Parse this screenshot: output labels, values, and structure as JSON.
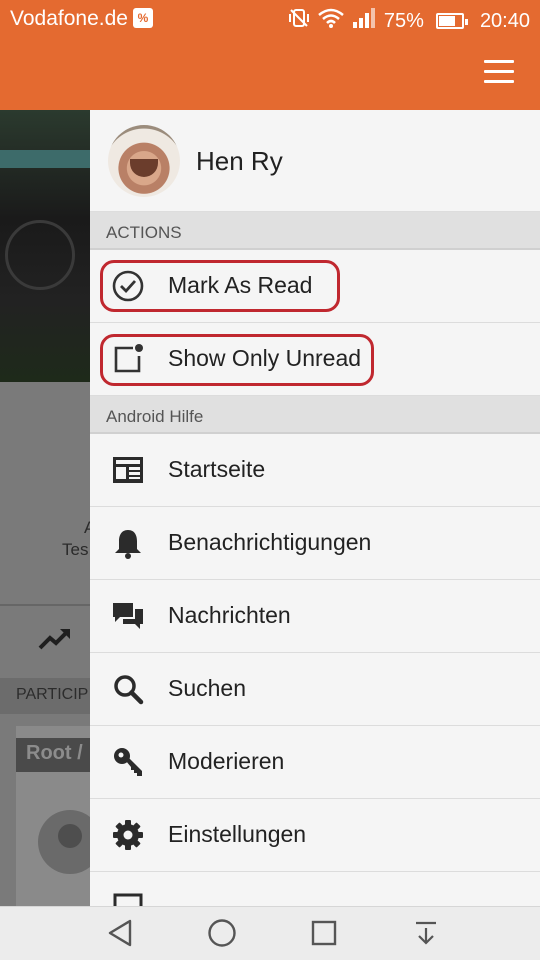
{
  "status_bar": {
    "carrier": "Vodafone.de",
    "carrier_badge": "%",
    "battery": "75%",
    "battery_level": 0.75,
    "time": "20:40"
  },
  "background": {
    "text_line1": "A",
    "text_line2": "Tes",
    "section": "PARTICIP",
    "card_title": "Root /"
  },
  "drawer": {
    "user_name": "Hen Ry",
    "actions_header": "ACTIONS",
    "actions": [
      {
        "label": "Mark As Read",
        "icon": "check-circle-icon"
      },
      {
        "label": "Show Only Unread",
        "icon": "unread-square-icon"
      }
    ],
    "forum_header": "Android Hilfe",
    "forum_items": [
      {
        "label": "Startseite",
        "icon": "newspaper-icon"
      },
      {
        "label": "Benachrichtigungen",
        "icon": "bell-icon"
      },
      {
        "label": "Nachrichten",
        "icon": "chat-icon"
      },
      {
        "label": "Suchen",
        "icon": "search-icon"
      },
      {
        "label": "Moderieren",
        "icon": "key-icon"
      },
      {
        "label": "Einstellungen",
        "icon": "gear-icon"
      }
    ]
  },
  "colors": {
    "accent": "#e46a30",
    "highlight": "#c0282f"
  }
}
